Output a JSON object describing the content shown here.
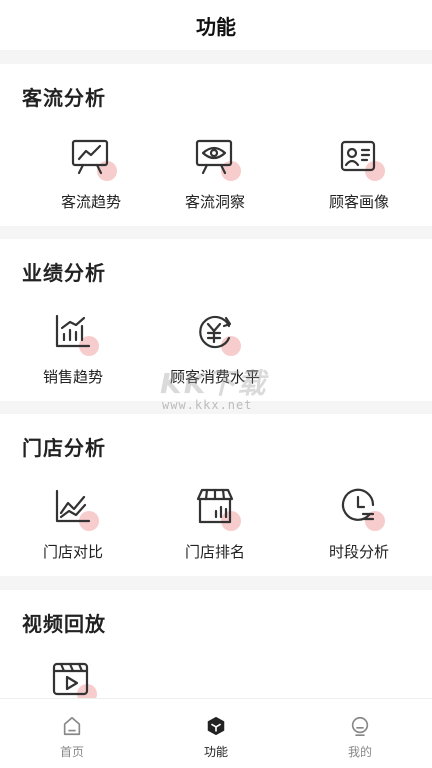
{
  "header": {
    "title": "功能"
  },
  "sections": [
    {
      "title": "客流分析",
      "items": [
        {
          "label": "客流趋势",
          "icon": "chart-board-icon"
        },
        {
          "label": "客流洞察",
          "icon": "eye-board-icon"
        },
        {
          "label": "顾客画像",
          "icon": "profile-card-icon"
        }
      ]
    },
    {
      "title": "业绩分析",
      "items": [
        {
          "label": "销售趋势",
          "icon": "bar-chart-icon"
        },
        {
          "label": "顾客消费水平",
          "icon": "yen-cycle-icon"
        }
      ]
    },
    {
      "title": "门店分析",
      "items": [
        {
          "label": "门店对比",
          "icon": "line-chart-icon"
        },
        {
          "label": "门店排名",
          "icon": "store-rank-icon"
        },
        {
          "label": "时段分析",
          "icon": "clock-icon"
        }
      ]
    },
    {
      "title": "视频回放",
      "items": [
        {
          "label": "",
          "icon": "video-play-icon"
        }
      ]
    }
  ],
  "watermark": {
    "text": "KK下载",
    "url": "www.kkx.net"
  },
  "tabbar": [
    {
      "label": "首页",
      "icon": "home-icon",
      "active": false
    },
    {
      "label": "功能",
      "icon": "cube-icon",
      "active": true
    },
    {
      "label": "我的",
      "icon": "user-icon",
      "active": false
    }
  ],
  "colors": {
    "accent_dot": "#f6c7c7",
    "icon_stroke": "#333333",
    "background": "#f5f5f5"
  }
}
